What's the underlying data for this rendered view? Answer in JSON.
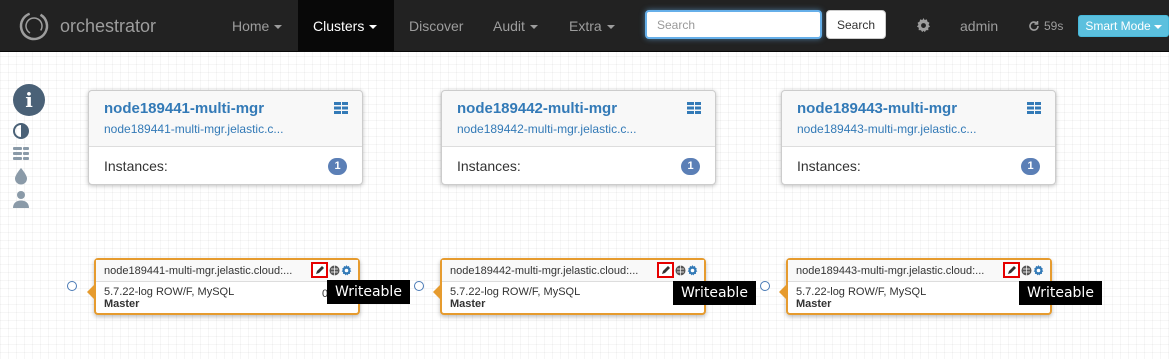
{
  "navbar": {
    "brand": "orchestrator",
    "menu": [
      {
        "label": "Home",
        "has_caret": true
      },
      {
        "label": "Clusters",
        "has_caret": true,
        "active": true
      },
      {
        "label": "Discover",
        "has_caret": false
      },
      {
        "label": "Audit",
        "has_caret": true
      },
      {
        "label": "Extra",
        "has_caret": true
      }
    ],
    "search_placeholder": "Search",
    "search_button": "Search",
    "settings_icon": "gear-icon",
    "user": "admin",
    "refresh_countdown": "59s",
    "mode_button": "Smart Mode"
  },
  "sidebar": {
    "icons": [
      "info-icon",
      "contrast-icon",
      "cluster-icon",
      "tint-icon",
      "user-icon"
    ]
  },
  "clusters": [
    {
      "name": "node189441-multi-mgr",
      "alias": "node189441-multi-mgr.jelastic.c...",
      "instances_label": "Instances:",
      "instances_count": "1",
      "instance": {
        "host": "node189441-multi-mgr.jelastic.cloud:...",
        "version": "5.7.22-log ROW/F, MySQL",
        "role": "Master",
        "truncated": "0",
        "tooltip": "Writeable"
      }
    },
    {
      "name": "node189442-multi-mgr",
      "alias": "node189442-multi-mgr.jelastic.c...",
      "instances_label": "Instances:",
      "instances_count": "1",
      "instance": {
        "host": "node189442-multi-mgr.jelastic.cloud:...",
        "version": "5.7.22-log ROW/F, MySQL",
        "role": "Master",
        "truncated": "",
        "tooltip": "Writeable"
      }
    },
    {
      "name": "node189443-multi-mgr",
      "alias": "node189443-multi-mgr.jelastic.c...",
      "instances_label": "Instances:",
      "instances_count": "1",
      "instance": {
        "host": "node189443-multi-mgr.jelastic.cloud:...",
        "version": "5.7.22-log ROW/F, MySQL",
        "role": "Master",
        "truncated": "",
        "tooltip": "Writeable"
      }
    }
  ],
  "colors": {
    "navbar": "#222222",
    "accent": "#337ab7",
    "instance_border": "#e69b2e",
    "highlight": "#e60000",
    "smart_mode": "#5bc0de"
  }
}
